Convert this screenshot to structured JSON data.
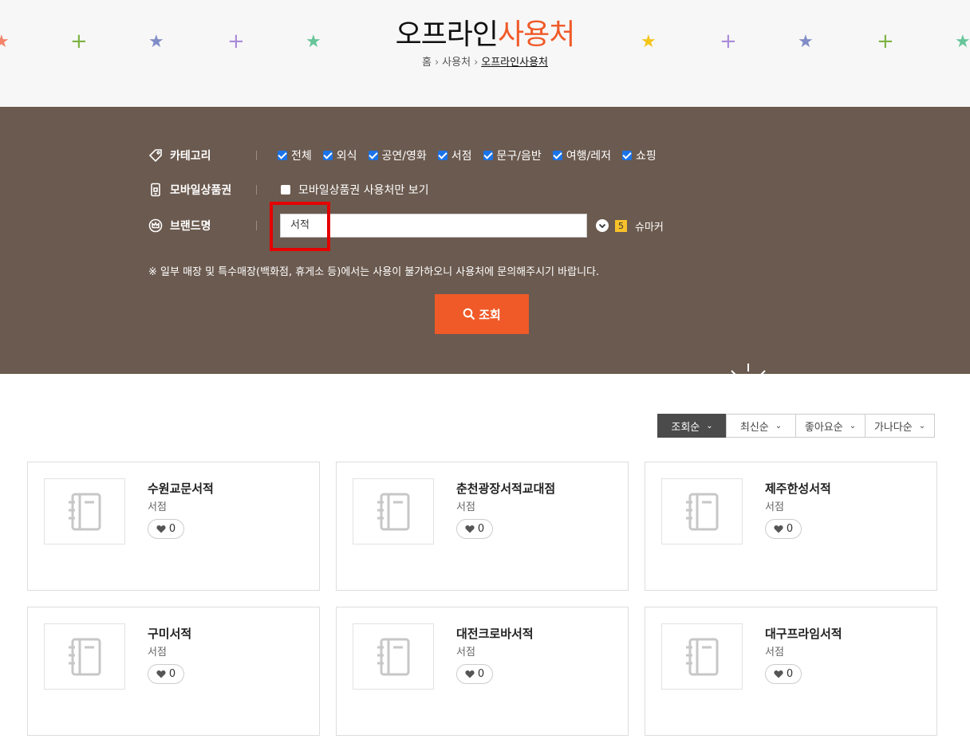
{
  "header": {
    "title_main": "오프라인",
    "title_accent": "사용처",
    "breadcrumb": [
      "홈",
      "사용처",
      "오프라인사용처"
    ]
  },
  "decorations": [
    {
      "icon": "star-icon",
      "color": "#f4846a"
    },
    {
      "icon": "plus-icon",
      "color": "#7cb342"
    },
    {
      "icon": "star-icon",
      "color": "#7f8cc7"
    },
    {
      "icon": "plus-icon",
      "color": "#a98bd8"
    },
    {
      "icon": "star-icon",
      "color": "#66c59a"
    },
    {
      "icon": "star-icon",
      "color": "#f5c518"
    },
    {
      "icon": "plus-icon",
      "color": "#a98bd8"
    },
    {
      "icon": "star-icon",
      "color": "#7f8cc7"
    },
    {
      "icon": "plus-icon",
      "color": "#7cb342"
    },
    {
      "icon": "star-icon",
      "color": "#66c59a"
    }
  ],
  "filters": {
    "category": {
      "label": "카테고리",
      "options": [
        {
          "label": "전체",
          "checked": true
        },
        {
          "label": "외식",
          "checked": true
        },
        {
          "label": "공연/영화",
          "checked": true
        },
        {
          "label": "서점",
          "checked": true
        },
        {
          "label": "문구/음반",
          "checked": true
        },
        {
          "label": "여행/레저",
          "checked": true
        },
        {
          "label": "쇼핑",
          "checked": true
        }
      ]
    },
    "mobile": {
      "label": "모바일상품권",
      "option": "모바일상품권 사용처만 보기",
      "checked": false
    },
    "brand": {
      "label": "브랜드명",
      "value": "서적",
      "rank": "5",
      "suggestion": "슈마커"
    },
    "notice": "※ 일부 매장 및 특수매장(백화점, 휴게소 등)에서는 사용이 불가하오니 사용처에 문의해주시기 바랍니다.",
    "search_label": "조회"
  },
  "sort": {
    "tabs": [
      "조회순",
      "최신순",
      "좋아요순",
      "가나다순"
    ],
    "active": 0
  },
  "stores": [
    {
      "name": "수원교문서적",
      "category": "서점",
      "likes": "0"
    },
    {
      "name": "춘천광장서적교대점",
      "category": "서점",
      "likes": "0"
    },
    {
      "name": "제주한성서적",
      "category": "서점",
      "likes": "0"
    },
    {
      "name": "구미서적",
      "category": "서점",
      "likes": "0"
    },
    {
      "name": "대전크로바서적",
      "category": "서점",
      "likes": "0"
    },
    {
      "name": "대구프라임서적",
      "category": "서점",
      "likes": "0"
    }
  ],
  "colors": {
    "accent": "#f05a28",
    "panel": "#6b5a4f",
    "highlight": "#e40000",
    "checkbox": "#1a73e8"
  }
}
